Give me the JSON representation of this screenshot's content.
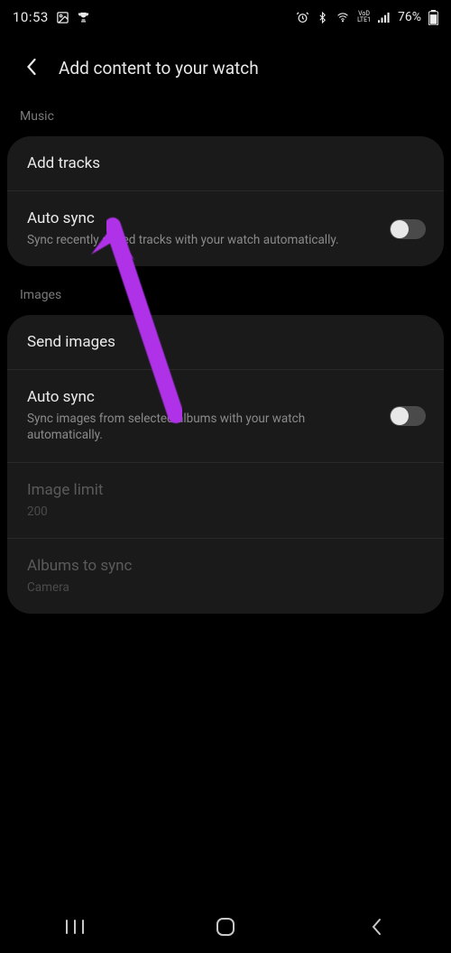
{
  "status": {
    "time": "10:53",
    "battery": "76%"
  },
  "header": {
    "title": "Add content to your watch"
  },
  "sections": {
    "music": {
      "label": "Music",
      "add_tracks": "Add tracks",
      "auto_sync_title": "Auto sync",
      "auto_sync_desc": "Sync recently added tracks with your watch automatically.",
      "auto_sync_on": false
    },
    "images": {
      "label": "Images",
      "send_images": "Send images",
      "auto_sync_title": "Auto sync",
      "auto_sync_desc": "Sync images from selected albums with your watch automatically.",
      "auto_sync_on": false,
      "image_limit_title": "Image limit",
      "image_limit_value": "200",
      "albums_title": "Albums to sync",
      "albums_value": "Camera"
    }
  }
}
